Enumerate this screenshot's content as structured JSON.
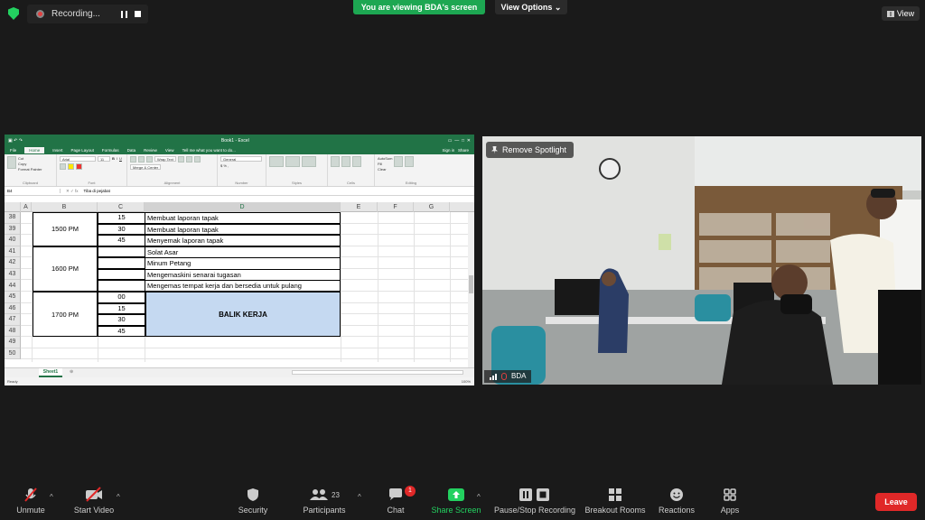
{
  "topbar": {
    "recording": "Recording...",
    "viewing": "You are viewing BDA's screen",
    "view_options": "View Options",
    "view": "View"
  },
  "excel": {
    "title": "Book1 - Excel",
    "tabs": [
      "File",
      "Home",
      "Insert",
      "Page Layout",
      "Formulas",
      "Data",
      "Review",
      "View"
    ],
    "tell_me": "Tell me what you want to do...",
    "sign_in": "Sign in",
    "share": "Share",
    "ribbon": {
      "font": "Arial",
      "size": "11",
      "number_format": "General",
      "wrap": "Wrap Text",
      "merge": "Merge & Center",
      "autosum": "AutoSum",
      "fill": "Fill",
      "clear": "Clear",
      "groups": [
        "Clipboard",
        "Font",
        "Alignment",
        "Number",
        "Styles",
        "Cells",
        "Editing"
      ],
      "buttons": [
        "Paste",
        "Cut",
        "Copy",
        "Format Painter",
        "Conditional Formatting",
        "Format as Table",
        "Cell Styles",
        "Insert",
        "Delete",
        "Format",
        "Sort & Filter",
        "Find & Select"
      ]
    },
    "name_box": "B4",
    "formula": "Tiba di pejabat",
    "columns": [
      "A",
      "B",
      "C",
      "D",
      "E",
      "F",
      "G"
    ],
    "rows": [
      "38",
      "39",
      "40",
      "41",
      "42",
      "43",
      "44",
      "45",
      "46",
      "47",
      "48",
      "49",
      "50"
    ],
    "times": [
      "1500 PM",
      "1600 PM",
      "1700 PM"
    ],
    "minutes": [
      "15",
      "30",
      "45",
      "",
      "",
      "",
      "",
      "00",
      "15",
      "30",
      "45"
    ],
    "activities": [
      "Membuat laporan tapak",
      "Membuat laporan tapak",
      "Menyemak laporan tapak",
      "Solat Asar",
      "Minum Petang",
      "Mengemaskini senarai tugasan",
      "Mengemas tempat kerja dan bersedia untuk pulang"
    ],
    "balik": "BALIK KERJA",
    "sheet": "Sheet1",
    "status": "Ready",
    "zoom": "100%"
  },
  "video": {
    "remove_spotlight": "Remove Spotlight",
    "name": "BDA"
  },
  "toolbar": {
    "unmute": "Unmute",
    "start_video": "Start Video",
    "security": "Security",
    "participants": "Participants",
    "participants_count": "23",
    "chat": "Chat",
    "chat_badge": "1",
    "share_screen": "Share Screen",
    "pause_recording": "Pause/Stop Recording",
    "breakout": "Breakout Rooms",
    "reactions": "Reactions",
    "apps": "Apps",
    "leave": "Leave"
  }
}
